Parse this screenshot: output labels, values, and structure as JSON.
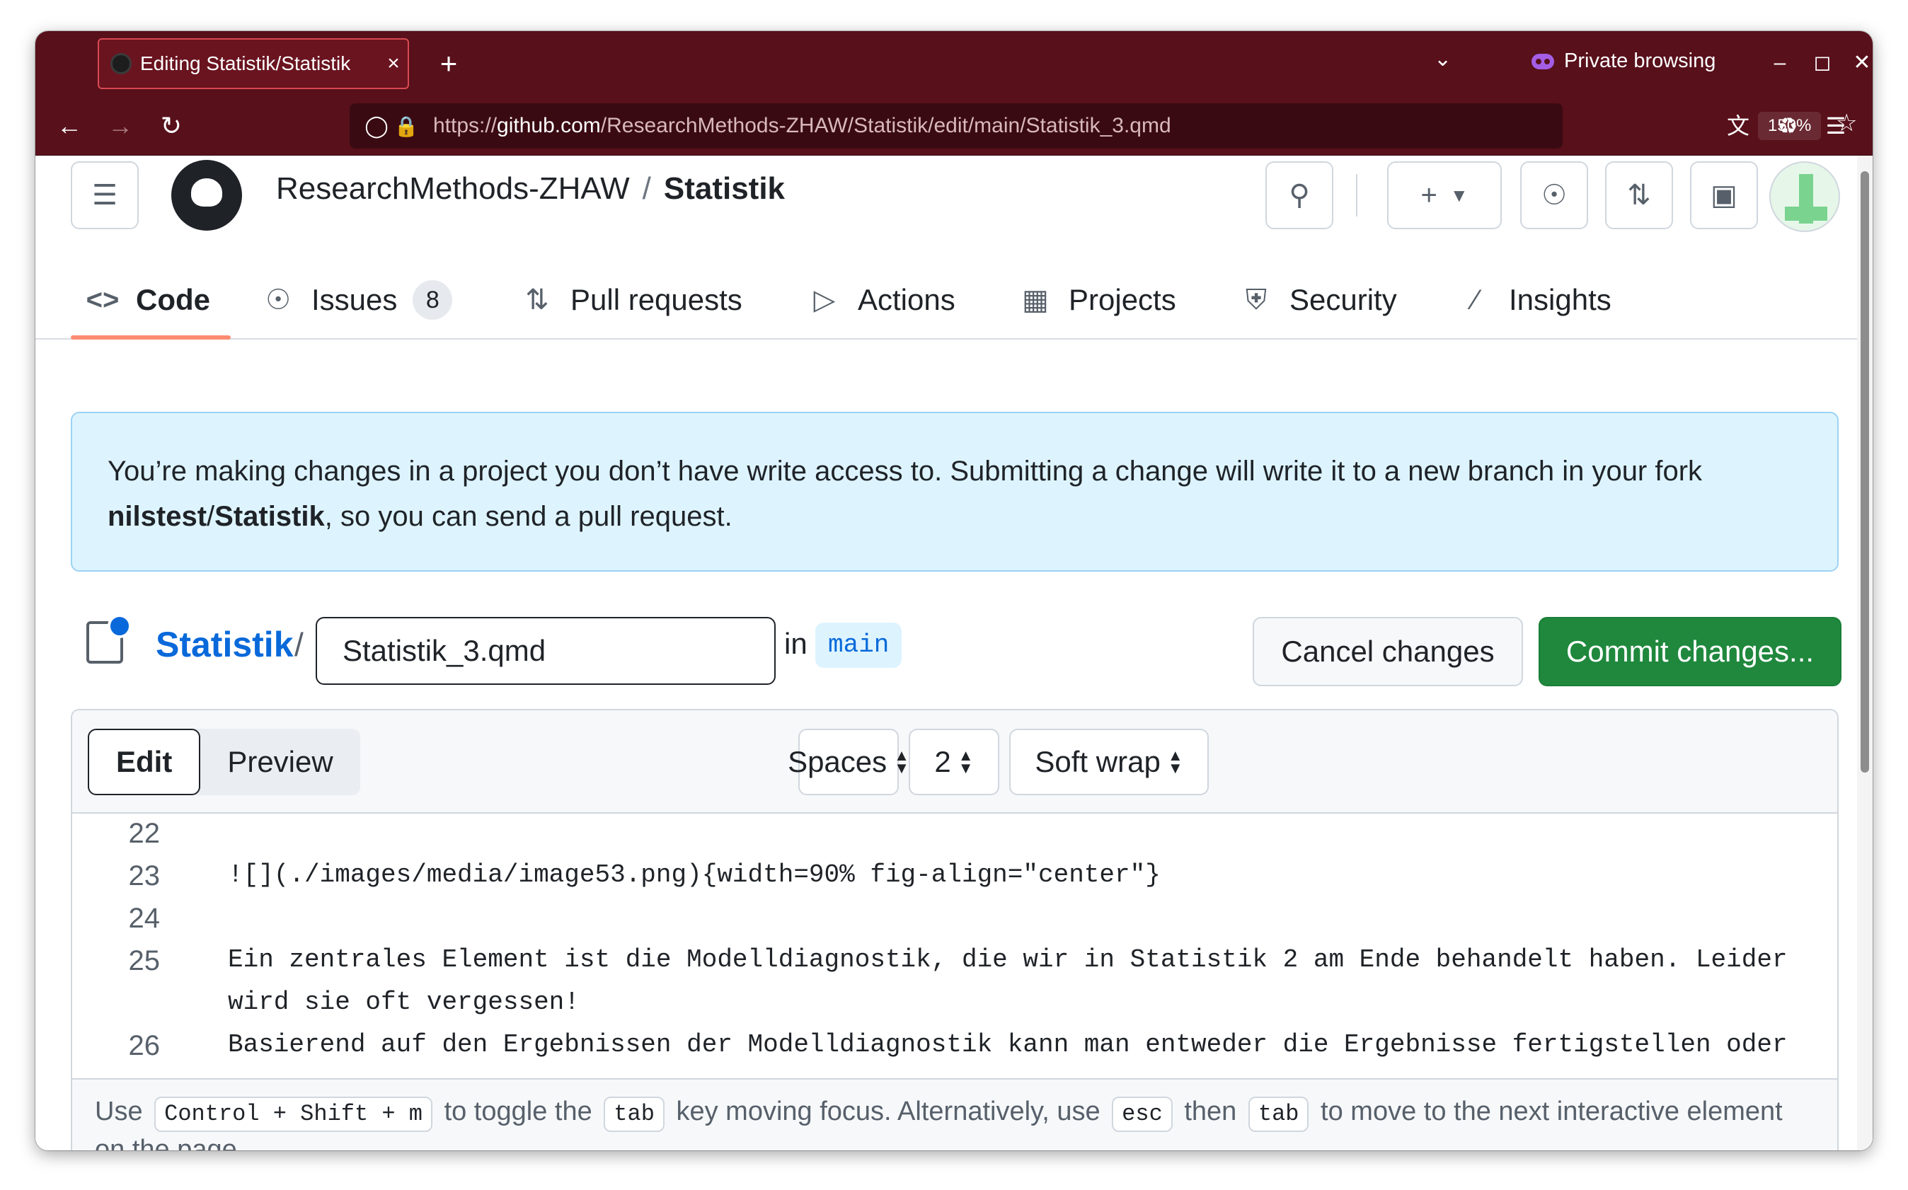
{
  "browser": {
    "tab_title": "Editing Statistik/Statistik",
    "tab_close": "×",
    "new_tab": "+",
    "list_tabs": "⌄",
    "private_label": "Private browsing",
    "url_prefix": "https://",
    "url_domain": "github.com",
    "url_path": "/ResearchMethods-ZHAW/Statistik/edit/main/Statistik_3.qmd",
    "zoom": "150%"
  },
  "header": {
    "org": "ResearchMethods-ZHAW",
    "separator": "/",
    "repo": "Statistik"
  },
  "repo_nav": {
    "code": "Code",
    "issues": "Issues",
    "issues_count": "8",
    "pull_requests": "Pull requests",
    "actions": "Actions",
    "projects": "Projects",
    "security": "Security",
    "insights": "Insights"
  },
  "flash": {
    "line1": "You’re making changes in a project you don’t have write access to. Submitting a change will write it to a new branch in your fork",
    "fork_owner": "nilstest",
    "fork_sep": "/",
    "fork_repo": "Statistik",
    "line2_rest": ", so you can send a pull request."
  },
  "editor_head": {
    "repo_link": "Statistik",
    "slash": "/",
    "filename": "Statistik_3.qmd",
    "in_label": "in",
    "branch": "main",
    "cancel": "Cancel changes",
    "commit": "Commit changes..."
  },
  "toolbar": {
    "edit": "Edit",
    "preview": "Preview",
    "indent_mode": "Spaces",
    "indent_size": "2",
    "wrap_mode": "Soft wrap"
  },
  "code_lines": [
    {
      "num": "22",
      "text": ""
    },
    {
      "num": "23",
      "text": "![](./images/media/image53.png){width=90% fig-align=\"center\"}"
    },
    {
      "num": "24",
      "text": ""
    },
    {
      "num": "25",
      "text": "Ein zentrales Element ist die Modelldiagnostik, die wir in Statistik 2 am Ende behandelt haben. Leider"
    },
    {
      "num": "",
      "text": "wird sie oft vergessen!"
    },
    {
      "num": "26",
      "text": "Basierend auf den Ergebnissen der Modelldiagnostik kann man entweder die Ergebnisse fertigstellen oder"
    }
  ],
  "help": {
    "t1": "Use",
    "k1": "Control + Shift + m",
    "t2": "to toggle the",
    "k2": "tab",
    "t3": "key moving focus. Alternatively, use",
    "k3": "esc",
    "t4": "then",
    "k4": "tab",
    "t5": "to move to the next interactive element",
    "t6": "on the page."
  },
  "colors": {
    "browser_chrome": "#58101b",
    "commit_green": "#1f883d",
    "link_blue": "#0969da",
    "flash_bg": "#ddf4ff",
    "nav_underline": "#fd8c73"
  }
}
